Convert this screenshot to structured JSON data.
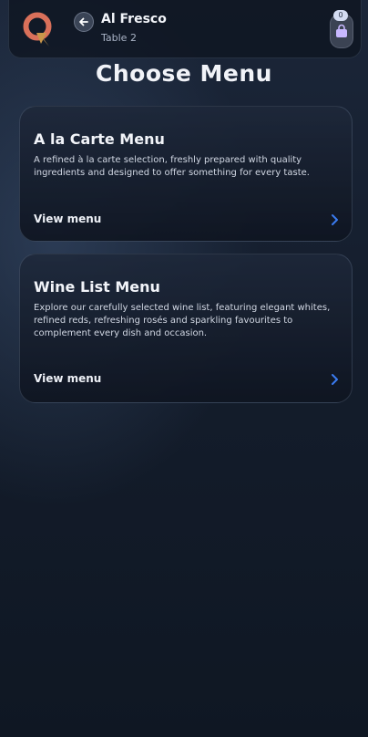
{
  "header": {
    "venue_name": "Al Fresco",
    "table_label": "Table 2",
    "cart_count": "0",
    "logo_icon": "q-logo-icon",
    "back_icon": "arrow-left-icon",
    "cart_icon": "shopping-bag-icon"
  },
  "page": {
    "title": "Choose Menu"
  },
  "menus": [
    {
      "title": "A la Carte Menu",
      "description": "A refined à la carte selection, freshly prepared with quality ingredients and designed to offer something for every taste.",
      "link_label": "View menu"
    },
    {
      "title": "Wine List Menu",
      "description": "Explore our carefully selected wine list, featuring elegant whites, refined reds, refreshing rosés and sparkling favourites to complement every dish and occasion.",
      "link_label": "View menu"
    }
  ],
  "colors": {
    "accent_link": "#3a7bf0",
    "background": "#141d2c",
    "logo_primary": "#d9705a",
    "logo_secondary": "#c9964a"
  }
}
